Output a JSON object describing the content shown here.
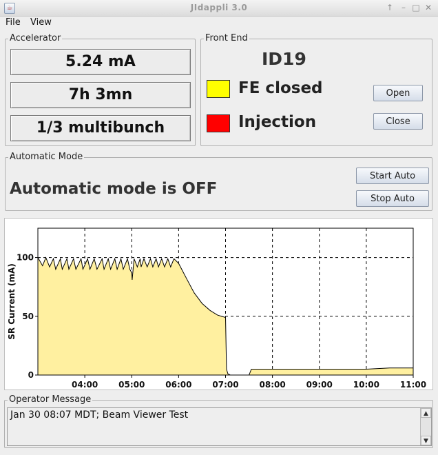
{
  "window": {
    "title": "JIdappli  3.0",
    "app_icon": "java-cup-icon",
    "controls": {
      "min": "↑",
      "restore": "–",
      "max": "□",
      "close": "✕"
    }
  },
  "menu": {
    "file": "File",
    "view": "View"
  },
  "accelerator": {
    "title": "Accelerator",
    "current": "5.24 mA",
    "lifetime": "7h 3mn",
    "mode": "1/3 multibunch"
  },
  "front_end": {
    "title": "Front End",
    "name": "ID19",
    "fe_status": {
      "label": "FE closed",
      "color": "#ffff00"
    },
    "injection": {
      "label": "Injection",
      "color": "#ff0000"
    },
    "open_label": "Open",
    "close_label": "Close"
  },
  "automatic": {
    "title": "Automatic Mode",
    "status": "Automatic mode is OFF",
    "start_label": "Start Auto",
    "stop_label": "Stop Auto"
  },
  "chart_data": {
    "type": "area",
    "title": "",
    "xlabel": "",
    "ylabel": "SR Current (mA)",
    "xlim": [
      3.0,
      11.0
    ],
    "ylim": [
      0,
      125
    ],
    "x_ticks": [
      "04:00",
      "05:00",
      "06:00",
      "07:00",
      "08:00",
      "09:00",
      "10:00",
      "11:00"
    ],
    "y_ticks": [
      "0",
      "50",
      "100"
    ],
    "grid": true,
    "fill_color": "#fff0a0",
    "line_color": "#000000",
    "x_hours": [
      3.0,
      3.1,
      3.17,
      3.25,
      3.33,
      3.38,
      3.48,
      3.52,
      3.62,
      3.66,
      3.76,
      3.81,
      3.92,
      3.96,
      4.06,
      4.11,
      4.2,
      4.26,
      4.37,
      4.41,
      4.5,
      4.55,
      4.64,
      4.69,
      4.77,
      4.82,
      4.91,
      4.96,
      5.0,
      5.01,
      5.05,
      5.12,
      5.18,
      5.2,
      5.26,
      5.33,
      5.4,
      5.45,
      5.52,
      5.57,
      5.64,
      5.7,
      5.77,
      5.83,
      5.9,
      6.0,
      6.17,
      6.33,
      6.5,
      6.67,
      6.83,
      7.0,
      7.02,
      7.05,
      7.1,
      7.3,
      7.5,
      7.55,
      8.0,
      8.5,
      9.0,
      9.5,
      10.0,
      10.5,
      11.0
    ],
    "values": [
      100,
      93,
      100,
      92,
      99,
      90,
      99,
      90,
      99,
      90,
      99,
      90,
      99,
      90,
      99,
      90,
      99,
      90,
      99,
      90,
      99,
      90,
      99,
      90,
      99,
      90,
      99,
      90,
      87,
      81,
      99,
      92,
      99,
      92,
      99,
      92,
      99,
      92,
      99,
      92,
      99,
      92,
      99,
      92,
      99,
      95,
      82,
      70,
      61,
      55,
      51,
      49,
      5,
      1,
      0,
      0,
      0,
      5,
      5,
      5,
      5,
      5,
      5,
      6,
      6
    ]
  },
  "operator": {
    "title": "Operator Message",
    "message": "Jan 30 08:07 MDT; Beam Viewer Test"
  }
}
